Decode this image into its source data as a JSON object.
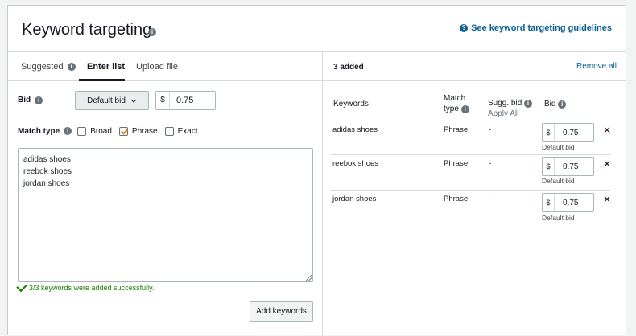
{
  "header": {
    "title": "Keyword targeting",
    "guidelines_link": "See keyword targeting guidelines"
  },
  "tabs": [
    {
      "label": "Suggested",
      "active": false
    },
    {
      "label": "Enter list",
      "active": true
    },
    {
      "label": "Upload file",
      "active": false
    }
  ],
  "form": {
    "bid_label": "Bid",
    "bid_mode": "Default bid",
    "currency": "$",
    "bid_value": "0.75",
    "match_type_label": "Match type",
    "match_options": [
      {
        "label": "Broad",
        "checked": false
      },
      {
        "label": "Phrase",
        "checked": true
      },
      {
        "label": "Exact",
        "checked": false
      }
    ],
    "keywords_text": [
      "adidas shoes",
      "reebok shoes",
      "jordan shoes"
    ],
    "success_message": "3/3 keywords were added successfully.",
    "add_button": "Add keywords"
  },
  "added_panel": {
    "count_label": "3 added",
    "remove_all": "Remove all",
    "columns": {
      "keywords": "Keywords",
      "match_type_1": "Match",
      "match_type_2": "type",
      "sugg_bid": "Sugg. bid",
      "apply_all": "Apply All",
      "bid": "Bid"
    },
    "rows": [
      {
        "keyword": "adidas shoes",
        "match_type": "Phrase",
        "sugg_bid": "-",
        "currency": "$",
        "bid": "0.75",
        "note": "Default bid",
        "remove": "✕"
      },
      {
        "keyword": "reebok shoes",
        "match_type": "Phrase",
        "sugg_bid": "-",
        "currency": "$",
        "bid": "0.75",
        "note": "Default bid",
        "remove": "✕"
      },
      {
        "keyword": "jordan shoes",
        "match_type": "Phrase",
        "sugg_bid": "-",
        "currency": "$",
        "bid": "0.75",
        "note": "Default bid",
        "remove": "✕"
      }
    ]
  },
  "colors": {
    "link": "#0b5e94",
    "success": "#1d8102",
    "checkbox_check": "#e47911"
  }
}
